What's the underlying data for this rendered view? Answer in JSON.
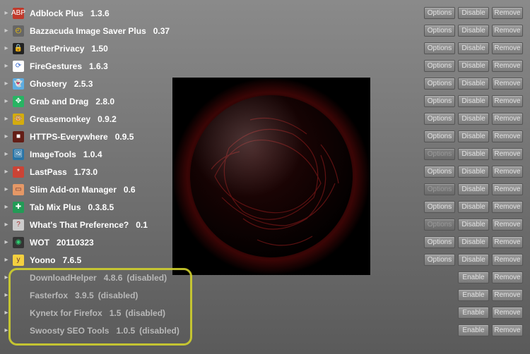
{
  "buttons": {
    "options": "Options",
    "disable": "Disable",
    "enable": "Enable",
    "remove": "Remove"
  },
  "disabled_label": "(disabled)",
  "addons": [
    {
      "name": "Adblock Plus",
      "version": "1.3.6",
      "enabled": true,
      "hasOptions": true,
      "iconBg": "#c0392b",
      "iconFg": "#fff",
      "glyph": "ABP"
    },
    {
      "name": "Bazzacuda Image Saver Plus",
      "version": "0.37",
      "enabled": true,
      "hasOptions": true,
      "iconBg": "#666",
      "iconFg": "#ffcc00",
      "glyph": "◴"
    },
    {
      "name": "BetterPrivacy",
      "version": "1.50",
      "enabled": true,
      "hasOptions": true,
      "iconBg": "#222",
      "iconFg": "#e67e22",
      "glyph": "🔒"
    },
    {
      "name": "FireGestures",
      "version": "1.6.3",
      "enabled": true,
      "hasOptions": true,
      "iconBg": "#fff",
      "iconFg": "#3366cc",
      "glyph": "⟳"
    },
    {
      "name": "Ghostery",
      "version": "2.5.3",
      "enabled": true,
      "hasOptions": true,
      "iconBg": "#5dade2",
      "iconFg": "#fff",
      "glyph": "👻"
    },
    {
      "name": "Grab and Drag",
      "version": "2.8.0",
      "enabled": true,
      "hasOptions": true,
      "iconBg": "#28b463",
      "iconFg": "#fff",
      "glyph": "✥"
    },
    {
      "name": "Greasemonkey",
      "version": "0.9.2",
      "enabled": true,
      "hasOptions": true,
      "iconBg": "#d4ac0d",
      "iconFg": "#322",
      "glyph": "🐵"
    },
    {
      "name": "HTTPS-Everywhere",
      "version": "0.9.5",
      "enabled": true,
      "hasOptions": true,
      "iconBg": "#641e16",
      "iconFg": "#fff",
      "glyph": "■"
    },
    {
      "name": "ImageTools",
      "version": "1.0.4",
      "enabled": true,
      "hasOptions": false,
      "iconBg": "#2874a6",
      "iconFg": "#fff",
      "glyph": "🖼"
    },
    {
      "name": "LastPass",
      "version": "1.73.0",
      "enabled": true,
      "hasOptions": true,
      "iconBg": "#cb4335",
      "iconFg": "#fff",
      "glyph": "*"
    },
    {
      "name": "Slim Add-on Manager",
      "version": "0.6",
      "enabled": true,
      "hasOptions": false,
      "iconBg": "#e59866",
      "iconFg": "#633",
      "glyph": "▭"
    },
    {
      "name": "Tab Mix Plus",
      "version": "0.3.8.5",
      "enabled": true,
      "hasOptions": true,
      "iconBg": "#239b56",
      "iconFg": "#fff",
      "glyph": "✚"
    },
    {
      "name": "What's That Preference?",
      "version": "0.1",
      "enabled": true,
      "hasOptions": false,
      "iconBg": "#ccc",
      "iconFg": "#a33",
      "glyph": "?"
    },
    {
      "name": "WOT",
      "version": "20110323",
      "enabled": true,
      "hasOptions": true,
      "iconBg": "#333",
      "iconFg": "#2ecc71",
      "glyph": "◉"
    },
    {
      "name": "Yoono",
      "version": "7.6.5",
      "enabled": true,
      "hasOptions": true,
      "iconBg": "#f4d03f",
      "iconFg": "#633",
      "glyph": "y"
    },
    {
      "name": "DownloadHelper",
      "version": "4.8.6",
      "enabled": false,
      "hasOptions": false,
      "iconBg": "",
      "iconFg": "",
      "glyph": ""
    },
    {
      "name": "Fasterfox",
      "version": "3.9.5",
      "enabled": false,
      "hasOptions": false,
      "iconBg": "",
      "iconFg": "",
      "glyph": ""
    },
    {
      "name": "Kynetx for Firefox",
      "version": "1.5",
      "enabled": false,
      "hasOptions": false,
      "iconBg": "",
      "iconFg": "",
      "glyph": ""
    },
    {
      "name": "Swoosty SEO Tools",
      "version": "1.0.5",
      "enabled": false,
      "hasOptions": false,
      "iconBg": "",
      "iconFg": "",
      "glyph": ""
    }
  ]
}
